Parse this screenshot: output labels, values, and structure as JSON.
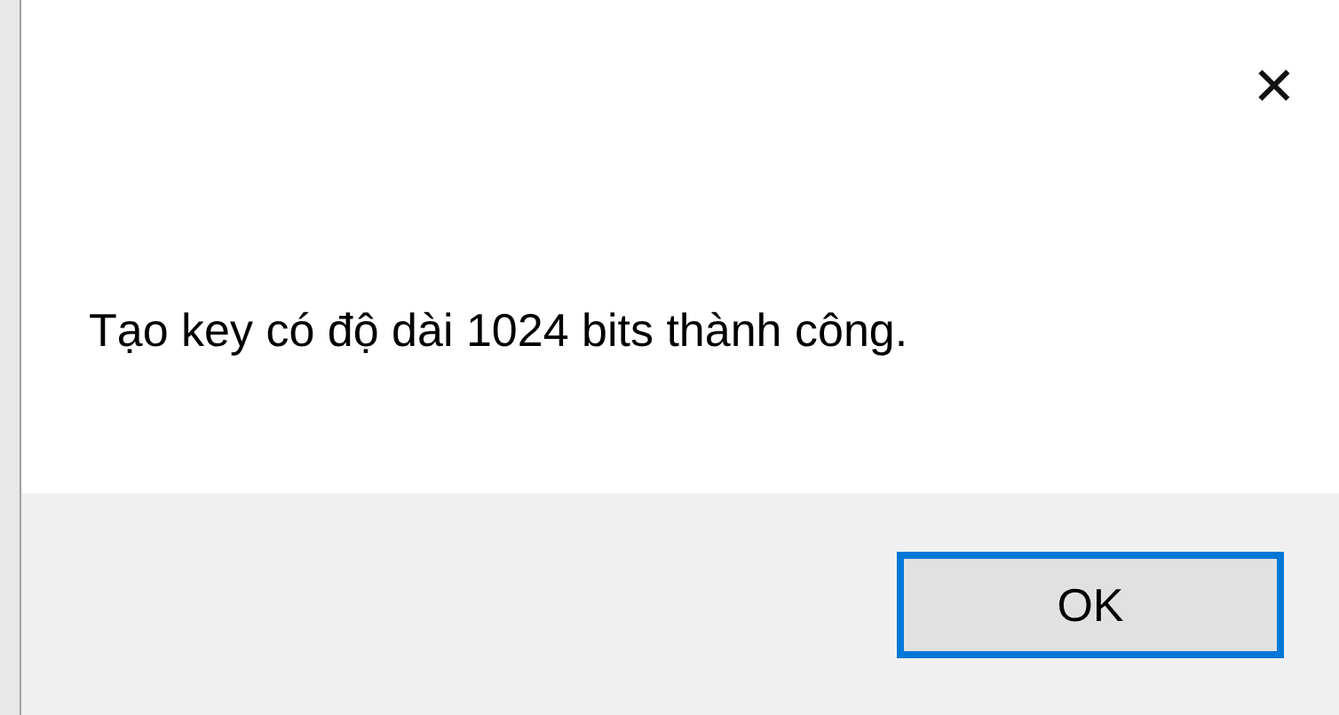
{
  "dialog": {
    "close_glyph": "✕",
    "message": "Tạo key có độ dài 1024 bits thành công.",
    "buttons": [
      {
        "label": "OK",
        "focused": true
      }
    ]
  }
}
